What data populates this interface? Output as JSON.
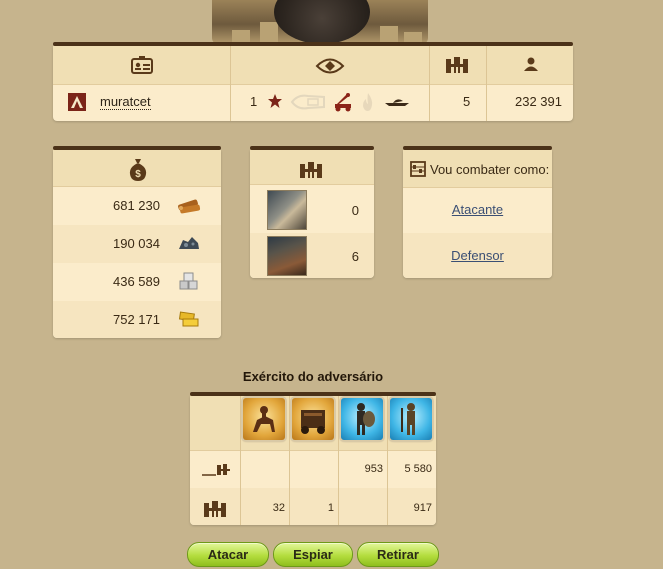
{
  "header": {
    "player_name": "muratcet",
    "level": "1",
    "towers": "5",
    "points": "232 391"
  },
  "resources": [
    {
      "value": "681 230",
      "icon": "wood-icon"
    },
    {
      "value": "190 034",
      "icon": "ore-icon"
    },
    {
      "value": "436 589",
      "icon": "stone-icon"
    },
    {
      "value": "752 171",
      "icon": "gold-icon"
    }
  ],
  "defenses": [
    {
      "value": "0",
      "icon": "tower-fortification-icon"
    },
    {
      "value": "6",
      "icon": "wall-icon"
    }
  ],
  "combat": {
    "title": "Vou combater como:",
    "attacker": "Atacante",
    "defender": "Defensor"
  },
  "army": {
    "title": "Exército do adversário",
    "units": [
      "cavalry-icon",
      "siege-icon",
      "shield-infantry-icon",
      "archer-icon"
    ],
    "row1": [
      "",
      "",
      "953",
      "5 580"
    ],
    "row2": [
      "32",
      "1",
      "",
      "917"
    ]
  },
  "buttons": {
    "attack": "Atacar",
    "spy": "Espiar",
    "retreat": "Retirar"
  },
  "colors": {
    "background": "#c6b48d",
    "panel": "#fbeccb",
    "panel_header": "#f0dfb4",
    "border": "#4b3219",
    "button": "#b4dd3e",
    "link": "#3b4f74",
    "icon": "#5a3a1a"
  }
}
